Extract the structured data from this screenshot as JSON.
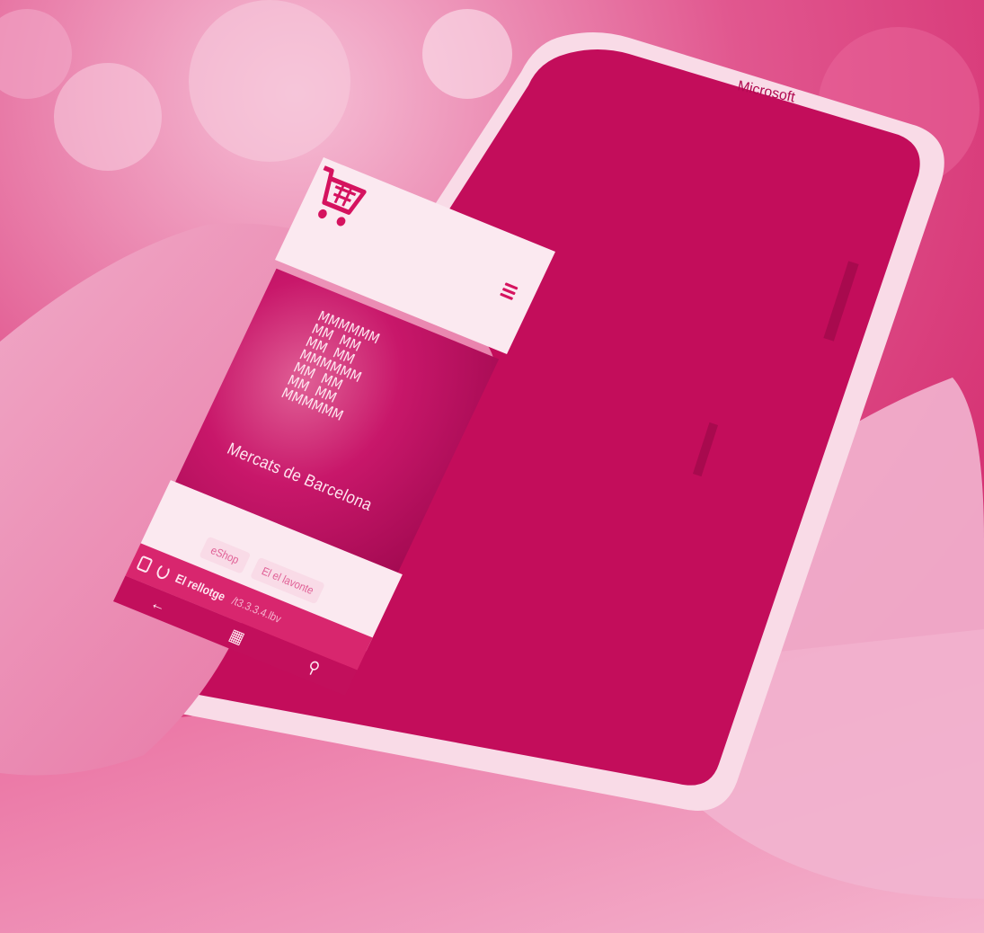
{
  "scene": {
    "description_colors": {
      "tint": "#d5135f",
      "light": "#fbe9f0",
      "skin": "#e77fa9"
    }
  },
  "phone": {
    "brand": "Microsoft",
    "header": {
      "cart_icon": "shopping-cart-icon",
      "menu_icon": "hamburger-menu-icon"
    },
    "banner": {
      "logo_text": "MMMMMM\nMM  MM\nMM  MM\nMMMMMM\nMM  MM\nMM  MM\nMMMMMM",
      "brand_name": "Mercats de Barcelona"
    },
    "chips": [
      "eShop",
      "El el lavonte"
    ],
    "address_bar": {
      "url_bold": "El rellotge",
      "url_rest": "/t3.3.3.4.lbv"
    },
    "nav_bar": {
      "back_icon": "back-arrow-icon",
      "home_icon": "windows-icon",
      "search_icon": "search-icon"
    }
  }
}
